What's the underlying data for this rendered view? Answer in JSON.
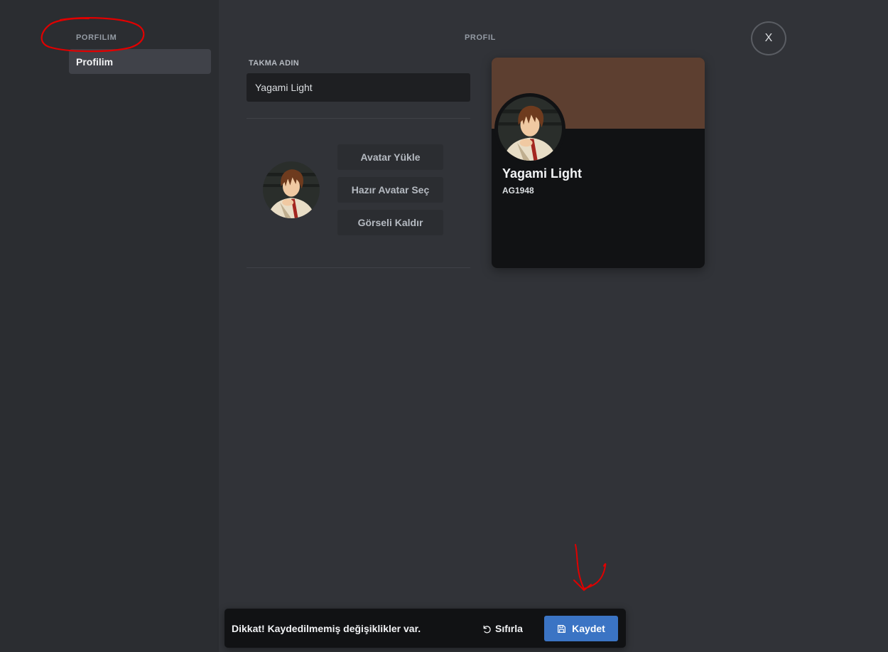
{
  "sidebar": {
    "heading": "PORFILIM",
    "items": [
      {
        "label": "Profilim",
        "selected": true
      }
    ]
  },
  "main": {
    "section_title": "PROFIL",
    "close_label": "X",
    "nickname": {
      "label": "TAKMA ADIN",
      "value": "Yagami Light"
    },
    "avatar_buttons": {
      "upload": "Avatar Yükle",
      "choose_preset": "Hazır Avatar Seç",
      "remove": "Görseli Kaldır"
    }
  },
  "preview": {
    "name": "Yagami Light",
    "tag": "AG1948",
    "banner_color": "#5d3f30"
  },
  "save_bar": {
    "message": "Dikkat! Kaydedilmemiş değişiklikler var.",
    "reset_label": "Sıfırla",
    "save_label": "Kaydet",
    "reset_icon": "undo-icon",
    "save_icon": "floppy-disk-icon",
    "save_color": "#3b74c4"
  },
  "colors": {
    "background": "#313338",
    "sidebar": "#2b2d31",
    "annotation": "#e00000"
  }
}
